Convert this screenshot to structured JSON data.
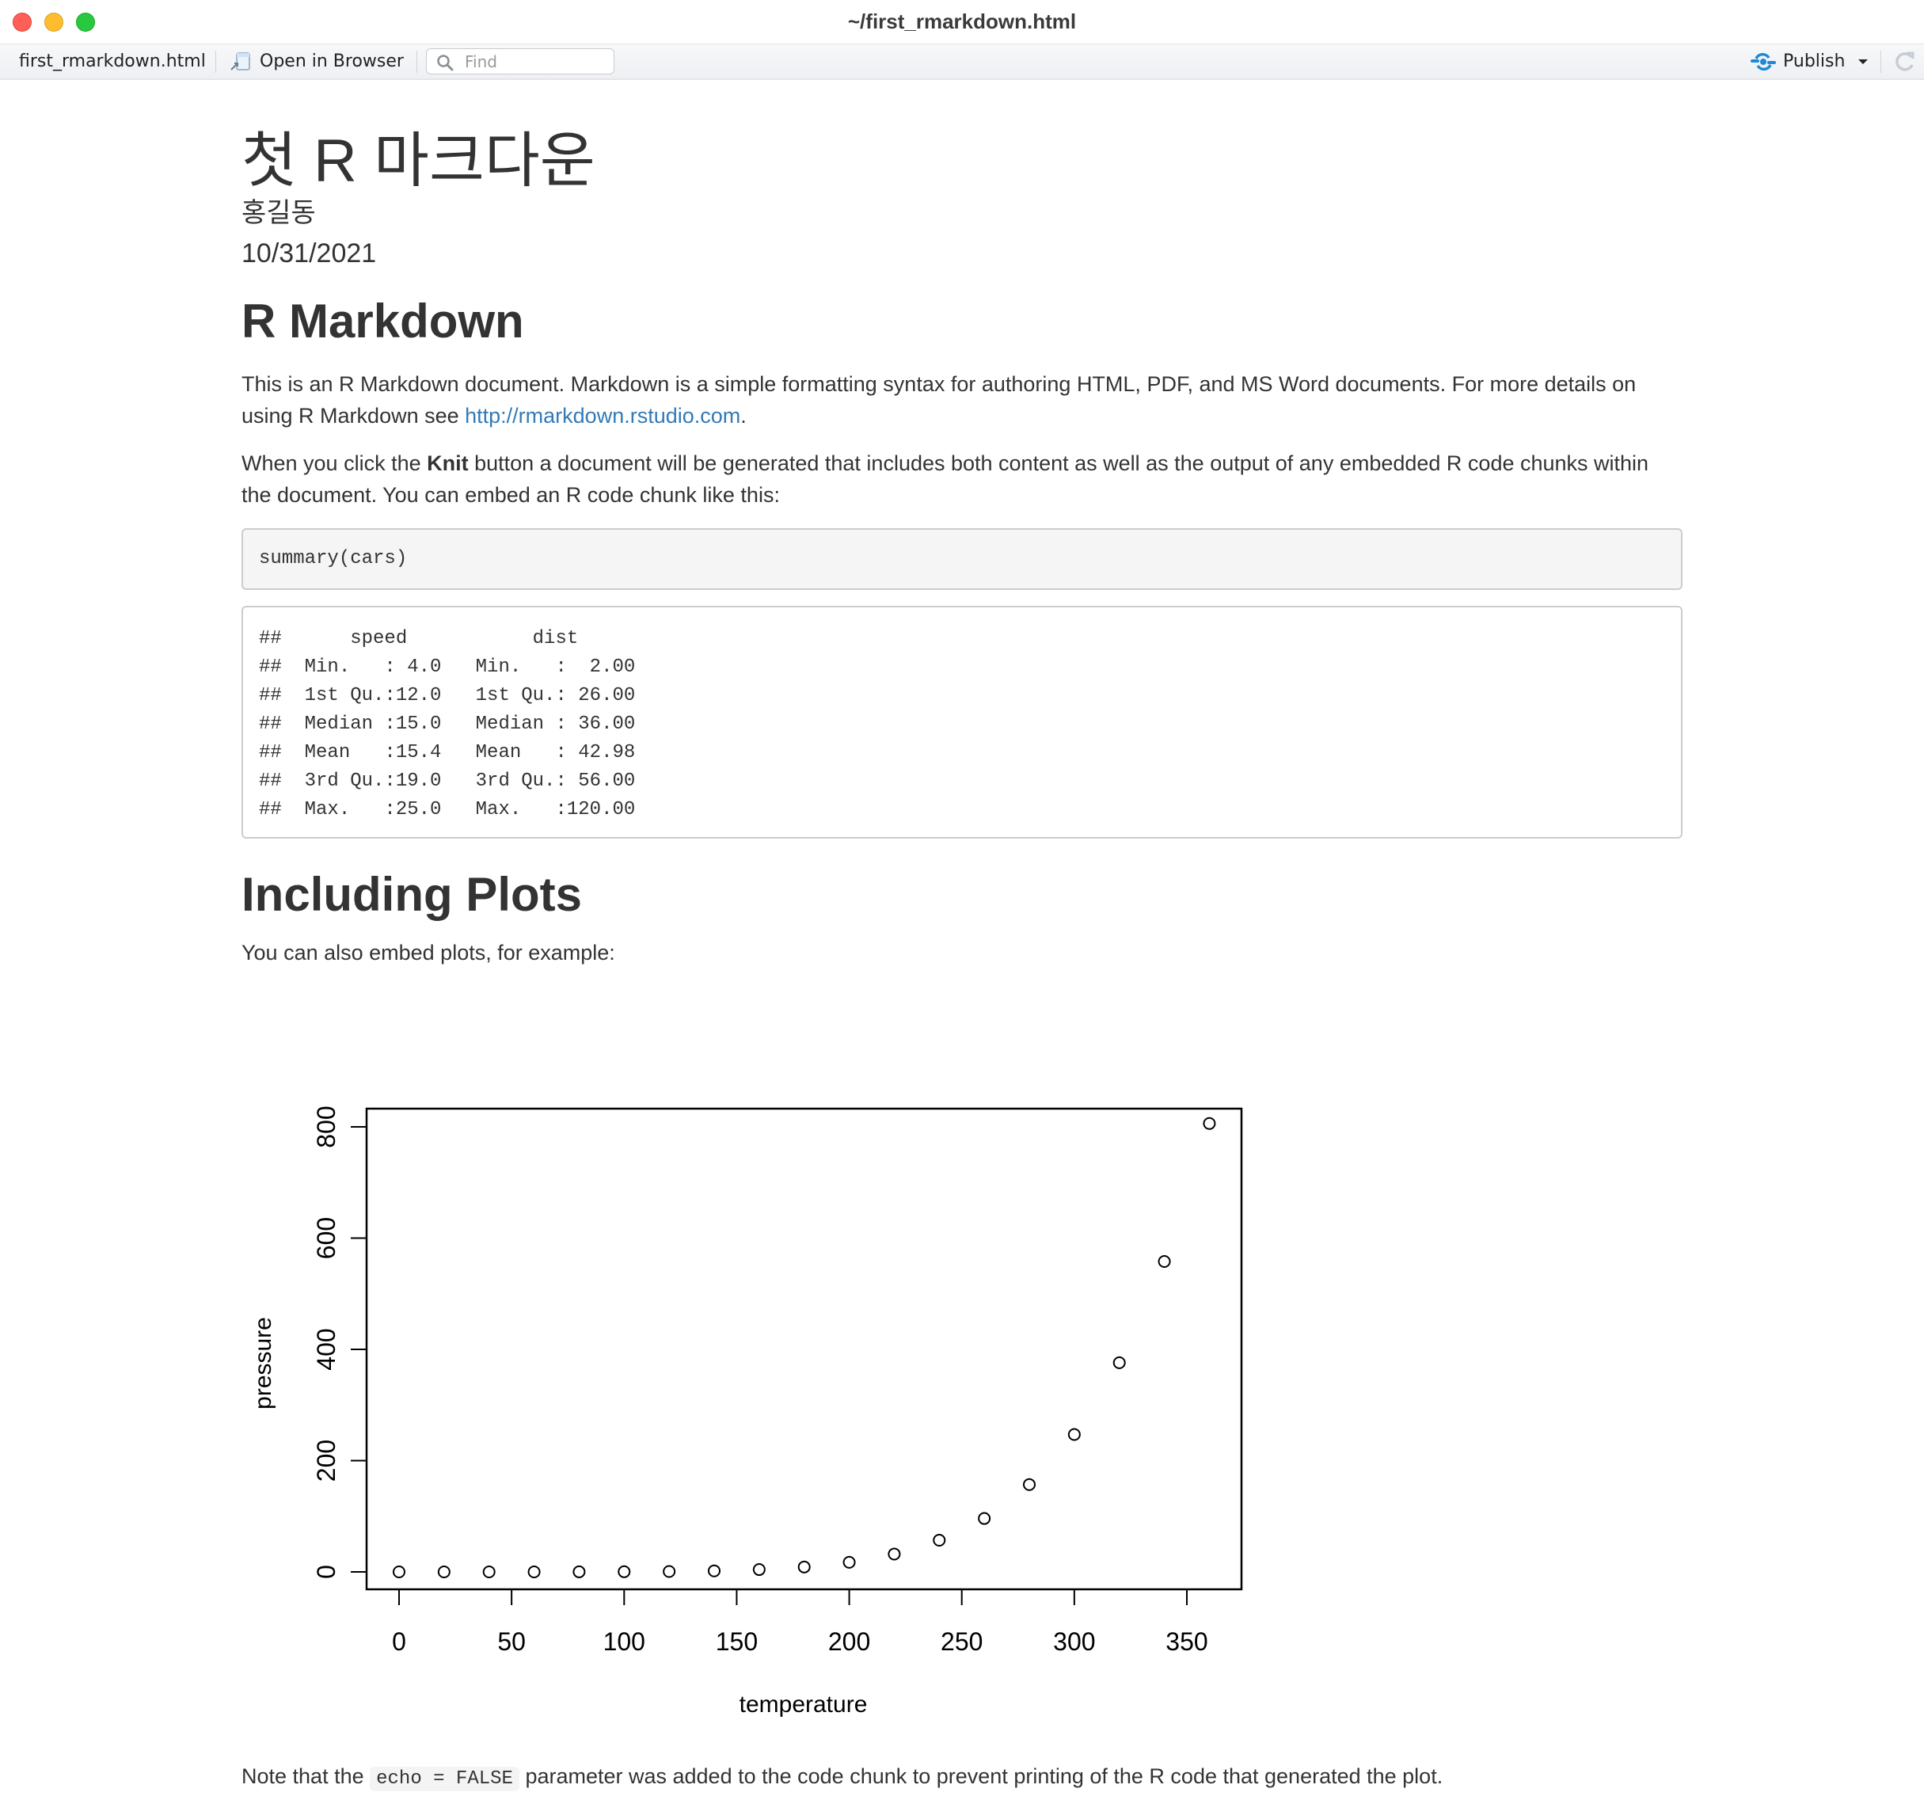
{
  "window": {
    "title": "~/first_rmarkdown.html"
  },
  "toolbar": {
    "file_tab": "first_rmarkdown.html",
    "open_in_browser": "Open in Browser",
    "find_placeholder": "Find",
    "publish": "Publish"
  },
  "document": {
    "title": "첫 R 마크다운",
    "author": "홍길동",
    "date": "10/31/2021",
    "section1_heading": "R Markdown",
    "para1_text": "This is an R Markdown document. Markdown is a simple formatting syntax for authoring HTML, PDF, and MS Word documents. For more details on using R Markdown see ",
    "para1_link": "http://rmarkdown.rstudio.com",
    "para1_end": ".",
    "para2_start": "When you click the ",
    "para2_bold": "Knit",
    "para2_end": " button a document will be generated that includes both content as well as the output of any embedded R code chunks within the document. You can embed an R code chunk like this:",
    "code_source": "summary(cars)",
    "code_output": [
      "##      speed           dist       ",
      "##  Min.   : 4.0   Min.   :  2.00  ",
      "##  1st Qu.:12.0   1st Qu.: 26.00  ",
      "##  Median :15.0   Median : 36.00  ",
      "##  Mean   :15.4   Mean   : 42.98  ",
      "##  3rd Qu.:19.0   3rd Qu.: 56.00  ",
      "##  Max.   :25.0   Max.   :120.00  "
    ],
    "section2_heading": "Including Plots",
    "para3": "You can also embed plots, for example:",
    "note_start": "Note that the ",
    "note_code": "echo = FALSE",
    "note_end": " parameter was added to the code chunk to prevent printing of the R code that generated the plot."
  },
  "chart_data": {
    "type": "scatter",
    "title": "",
    "xlabel": "temperature",
    "ylabel": "pressure",
    "xlim": [
      0,
      360
    ],
    "ylim": [
      0,
      806
    ],
    "x_ticks": [
      0,
      50,
      100,
      150,
      200,
      250,
      300,
      350
    ],
    "y_ticks": [
      0,
      200,
      400,
      600,
      800
    ],
    "grid": false,
    "marker": "open-circle",
    "x": [
      0,
      20,
      40,
      60,
      80,
      100,
      120,
      140,
      160,
      180,
      200,
      220,
      240,
      260,
      280,
      300,
      320,
      340,
      360
    ],
    "y": [
      0.0002,
      0.0012,
      0.006,
      0.03,
      0.09,
      0.27,
      0.75,
      1.85,
      4.2,
      8.8,
      17.3,
      32.1,
      57.0,
      96.0,
      157.0,
      247.0,
      376.0,
      558.0,
      806.0
    ]
  }
}
